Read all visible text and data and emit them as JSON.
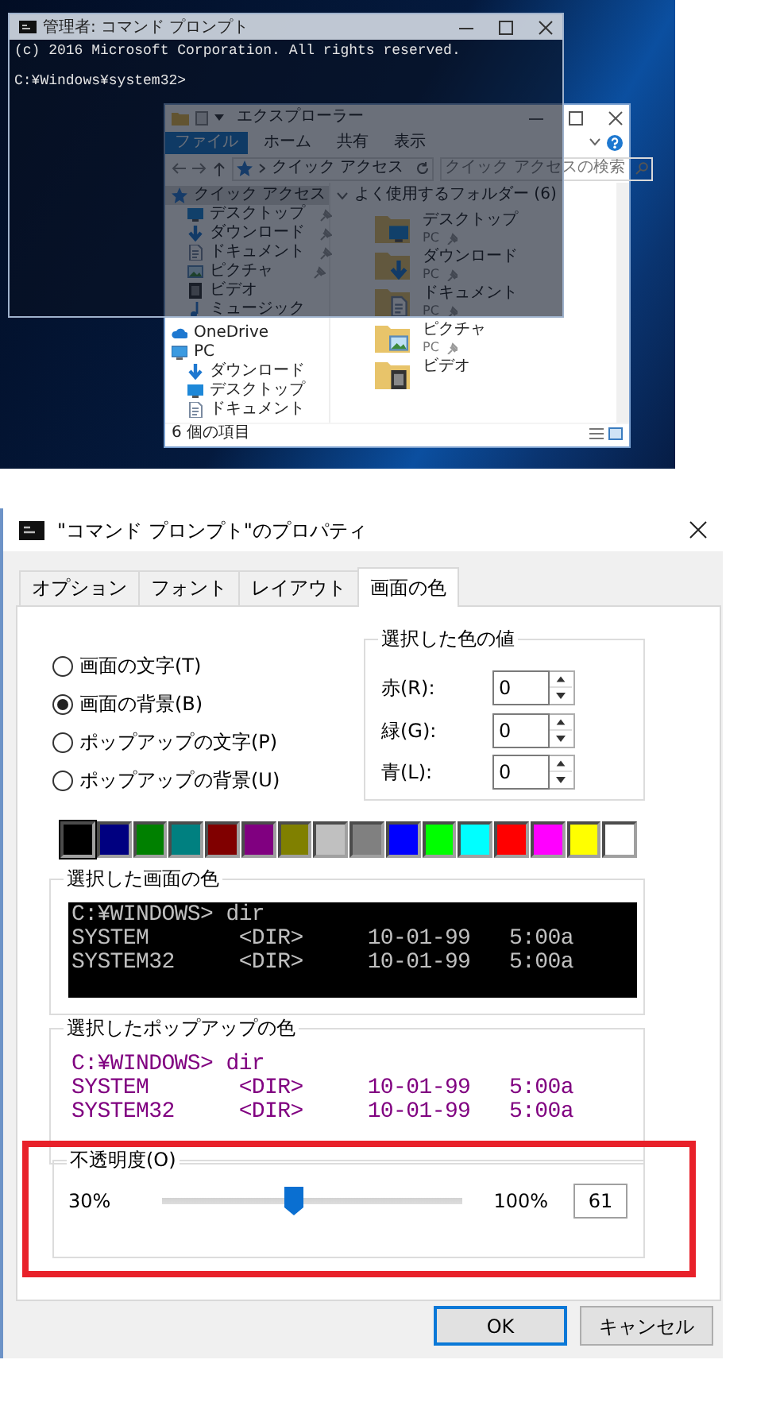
{
  "desktop": {
    "console_window": {
      "title": "管理者: コマンド プロンプト",
      "lines": [
        "(c) 2016 Microsoft Corporation. All rights reserved.",
        "C:¥Windows¥system32>"
      ]
    },
    "explorer_window": {
      "title": "エクスプローラー",
      "ribbon_tabs": [
        {
          "label": "ファイル",
          "selected": true
        },
        {
          "label": "ホーム",
          "selected": false
        },
        {
          "label": "共有",
          "selected": false
        },
        {
          "label": "表示",
          "selected": false
        }
      ],
      "address": "クイック アクセス",
      "search": {
        "placeholder": "クイック アクセスの検索"
      },
      "nav_items": [
        {
          "label": "クイック アクセス",
          "kind": "star",
          "selected": true,
          "children": [
            {
              "label": "デスクトップ",
              "kind": "desktop",
              "selected": false,
              "pinned": true
            },
            {
              "label": "ダウンロード",
              "kind": "download",
              "selected": false,
              "pinned": true
            },
            {
              "label": "ドキュメント",
              "kind": "document",
              "selected": false,
              "pinned": true
            },
            {
              "label": "ピクチャ",
              "kind": "picture",
              "selected": false,
              "pinned": true
            },
            {
              "label": "ビデオ",
              "kind": "video",
              "selected": false,
              "pinned": false
            },
            {
              "label": "ミュージック",
              "kind": "music",
              "selected": false,
              "pinned": false
            }
          ]
        },
        {
          "label": "OneDrive",
          "kind": "cloud",
          "selected": false
        },
        {
          "label": "PC",
          "kind": "pc",
          "selected": false,
          "children": [
            {
              "label": "ダウンロード",
              "kind": "download",
              "selected": false,
              "pinned": false
            },
            {
              "label": "デスクトップ",
              "kind": "desktop",
              "selected": false,
              "pinned": false
            },
            {
              "label": "ドキュメント",
              "kind": "document",
              "selected": false,
              "pinned": false
            }
          ]
        }
      ],
      "section_title": "よく使用するフォルダー (6)",
      "folders": [
        {
          "name": "デスクトップ",
          "location": "PC",
          "kind": "desktop"
        },
        {
          "name": "ダウンロード",
          "location": "PC",
          "kind": "download"
        },
        {
          "name": "ドキュメント",
          "location": "PC",
          "kind": "document"
        },
        {
          "name": "ピクチャ",
          "location": "PC",
          "kind": "picture"
        },
        {
          "name": "ビデオ",
          "kind": "video"
        }
      ],
      "status": "6 個の項目"
    }
  },
  "dialog": {
    "title": "\"コマンド プロンプト\"のプロパティ",
    "tabs": [
      {
        "label": "オプション",
        "selected": false
      },
      {
        "label": "フォント",
        "selected": false
      },
      {
        "label": "レイアウト",
        "selected": false
      },
      {
        "label": "画面の色",
        "selected": true
      }
    ],
    "radios": [
      {
        "label": "画面の文字(T)",
        "selected": false
      },
      {
        "label": "画面の背景(B)",
        "selected": true
      },
      {
        "label": "ポップアップの文字(P)",
        "selected": false
      },
      {
        "label": "ポップアップの背景(U)",
        "selected": false
      }
    ],
    "color_values": {
      "title": "選択した色の値",
      "fields": [
        {
          "label": "赤(R):",
          "value": "0"
        },
        {
          "label": "緑(G):",
          "value": "0"
        },
        {
          "label": "青(L):",
          "value": "0"
        }
      ]
    },
    "palette": [
      {
        "color": "#000000",
        "selected": true
      },
      {
        "color": "#000080",
        "selected": false
      },
      {
        "color": "#008000",
        "selected": false
      },
      {
        "color": "#008080",
        "selected": false
      },
      {
        "color": "#800000",
        "selected": false
      },
      {
        "color": "#800080",
        "selected": false
      },
      {
        "color": "#808000",
        "selected": false
      },
      {
        "color": "#c0c0c0",
        "selected": false
      },
      {
        "color": "#808080",
        "selected": false
      },
      {
        "color": "#0000ff",
        "selected": false
      },
      {
        "color": "#00ff00",
        "selected": false
      },
      {
        "color": "#00ffff",
        "selected": false
      },
      {
        "color": "#ff0000",
        "selected": false
      },
      {
        "color": "#ff00ff",
        "selected": false
      },
      {
        "color": "#ffff00",
        "selected": false
      },
      {
        "color": "#ffffff",
        "selected": false
      }
    ],
    "screen_preview": {
      "title": "選択した画面の色",
      "lines": [
        "C:¥WINDOWS> dir",
        "SYSTEM       <DIR>     10-01-99   5:00a",
        "SYSTEM32     <DIR>     10-01-99   5:00a"
      ]
    },
    "popup_preview": {
      "title": "選択したポップアップの色",
      "lines": [
        "C:¥WINDOWS> dir",
        "SYSTEM       <DIR>     10-01-99   5:00a",
        "SYSTEM32     <DIR>     10-01-99   5:00a"
      ]
    },
    "opacity": {
      "title": "不透明度(O)",
      "min_label": "30%",
      "max_label": "100%",
      "level": 0.443,
      "value": "61",
      "highlighted": true
    },
    "buttons": [
      {
        "label": "OK",
        "kind": "default"
      },
      {
        "label": "キャンセル",
        "kind": "normal"
      }
    ]
  }
}
